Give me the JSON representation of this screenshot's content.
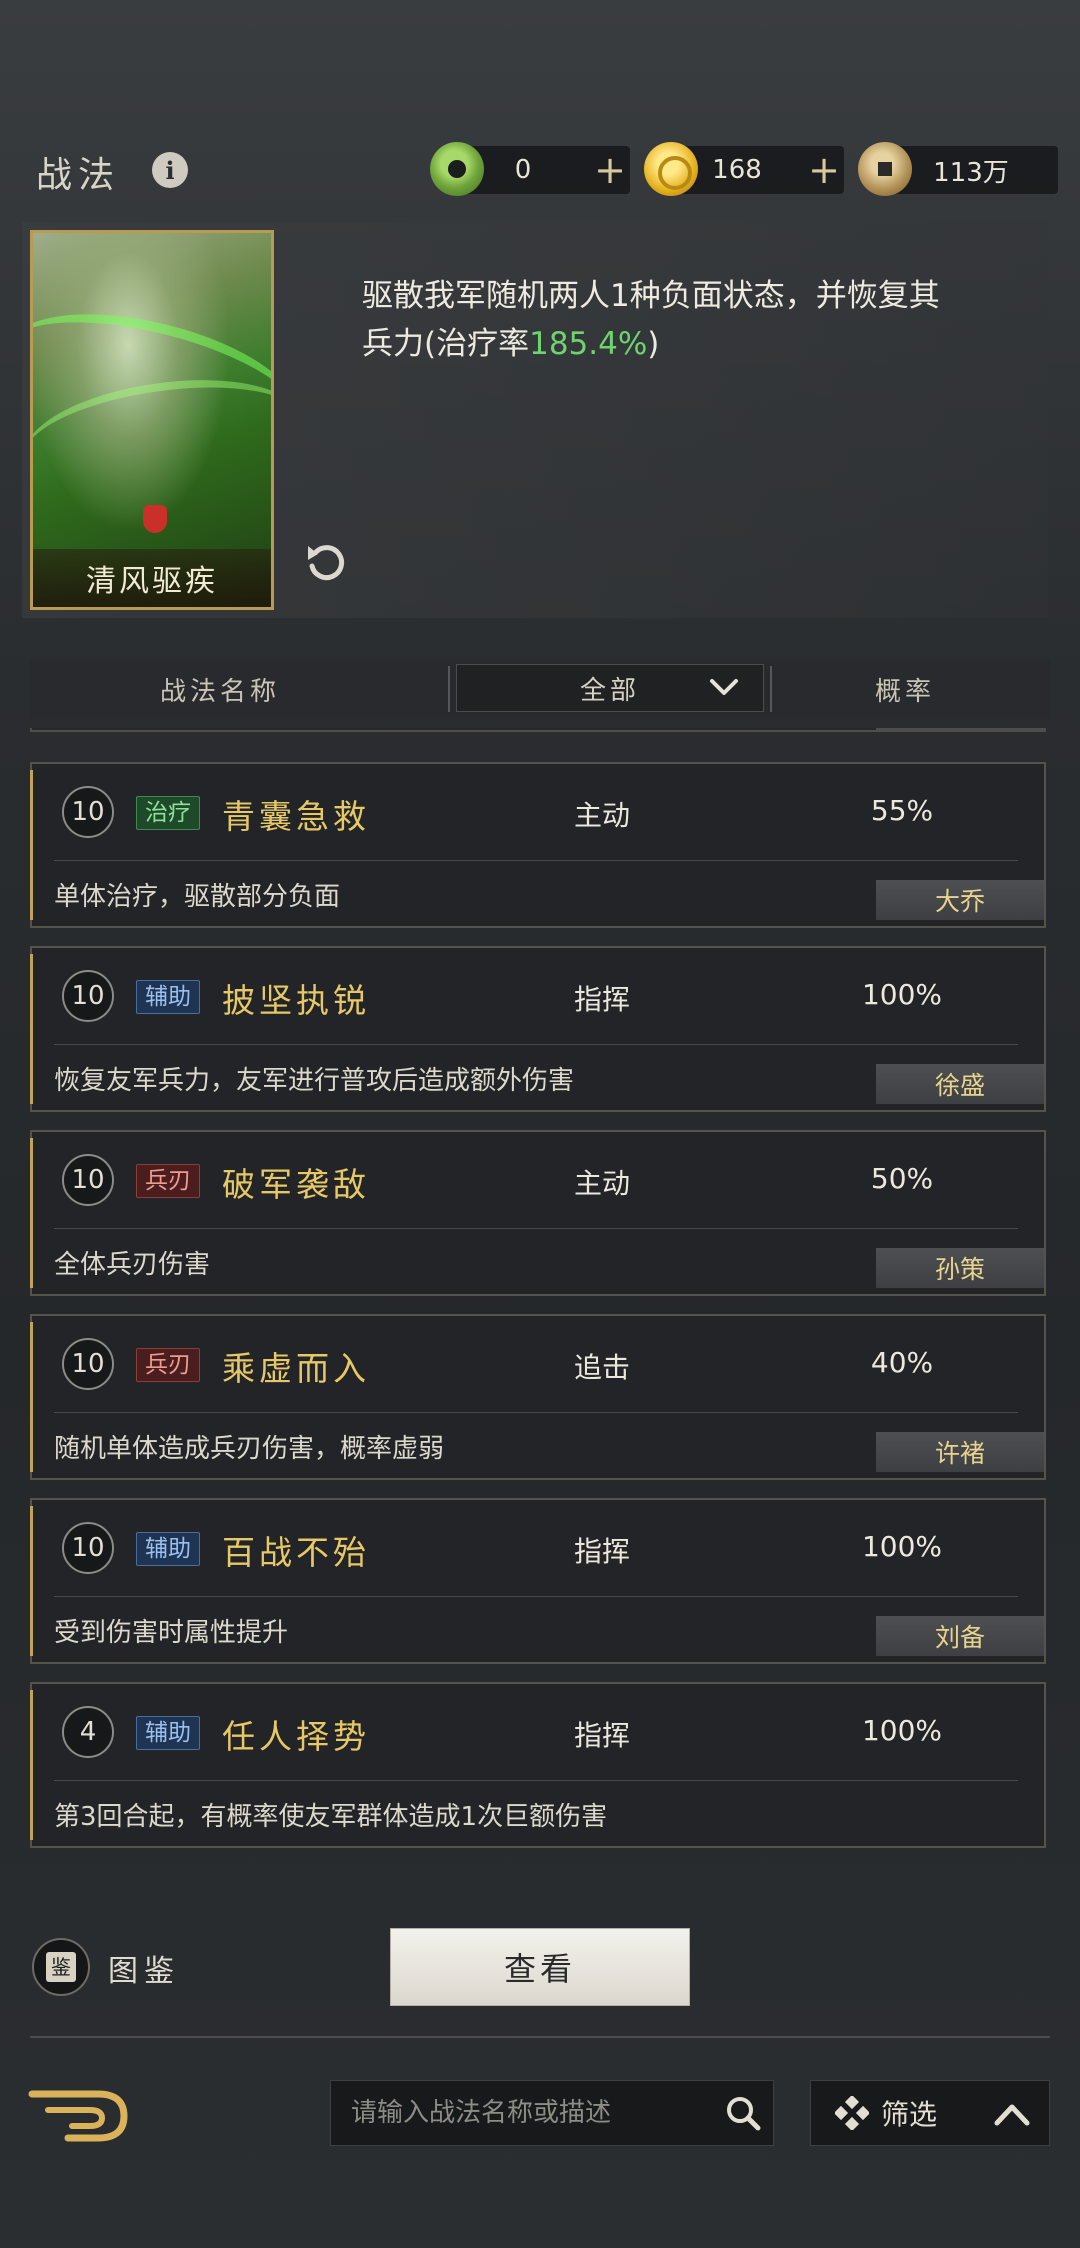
{
  "header": {
    "title": "战法",
    "info_icon": "info-icon",
    "currencies": [
      {
        "icon": "jade-coin-icon",
        "value": "0",
        "has_plus": true
      },
      {
        "icon": "gold-coin-icon",
        "value": "168",
        "has_plus": true
      },
      {
        "icon": "copper-coin-icon",
        "value": "113万",
        "has_plus": false
      }
    ],
    "plus_symbol": "+"
  },
  "featured": {
    "card_name": "清风驱疾",
    "desc_before": "驱散我军随机两人1种负面状态，并恢复其兵力(治疗率",
    "desc_value": "185.4%",
    "desc_after": ")",
    "value_color": "#6fd36f"
  },
  "table_header": {
    "name_label": "战法名称",
    "filter_value": "全部",
    "rate_label": "概率"
  },
  "tactics": [
    {
      "level": "10",
      "category": "治疗",
      "category_kind": "heal",
      "name": "青囊急救",
      "type": "主动",
      "rate": "55%",
      "desc": "单体治疗，驱散部分负面",
      "hero": "大乔"
    },
    {
      "level": "10",
      "category": "辅助",
      "category_kind": "assist",
      "name": "披坚执锐",
      "type": "指挥",
      "rate": "100%",
      "desc": "恢复友军兵力，友军进行普攻后造成额外伤害",
      "hero": "徐盛"
    },
    {
      "level": "10",
      "category": "兵刃",
      "category_kind": "blade",
      "name": "破军袭敌",
      "type": "主动",
      "rate": "50%",
      "desc": "全体兵刃伤害",
      "hero": "孙策"
    },
    {
      "level": "10",
      "category": "兵刃",
      "category_kind": "blade",
      "name": "乘虚而入",
      "type": "追击",
      "rate": "40%",
      "desc": "随机单体造成兵刃伤害，概率虚弱",
      "hero": "许褚"
    },
    {
      "level": "10",
      "category": "辅助",
      "category_kind": "assist",
      "name": "百战不殆",
      "type": "指挥",
      "rate": "100%",
      "desc": "受到伤害时属性提升",
      "hero": "刘备"
    },
    {
      "level": "4",
      "category": "辅助",
      "category_kind": "assist",
      "name": "任人择势",
      "type": "指挥",
      "rate": "100%",
      "desc": "第3回合起，有概率使友军群体造成1次巨额伤害",
      "hero": ""
    }
  ],
  "footer": {
    "codex_label": "图鉴",
    "codex_glyph": "鉴",
    "view_button": "查看",
    "search_placeholder": "请输入战法名称或描述",
    "filter_label": "筛选"
  },
  "colors": {
    "accent_gold": "#e6c867",
    "heal_green": "#8fe09a",
    "assist_blue": "#9cc0ee",
    "blade_red": "#ef9b8e"
  }
}
